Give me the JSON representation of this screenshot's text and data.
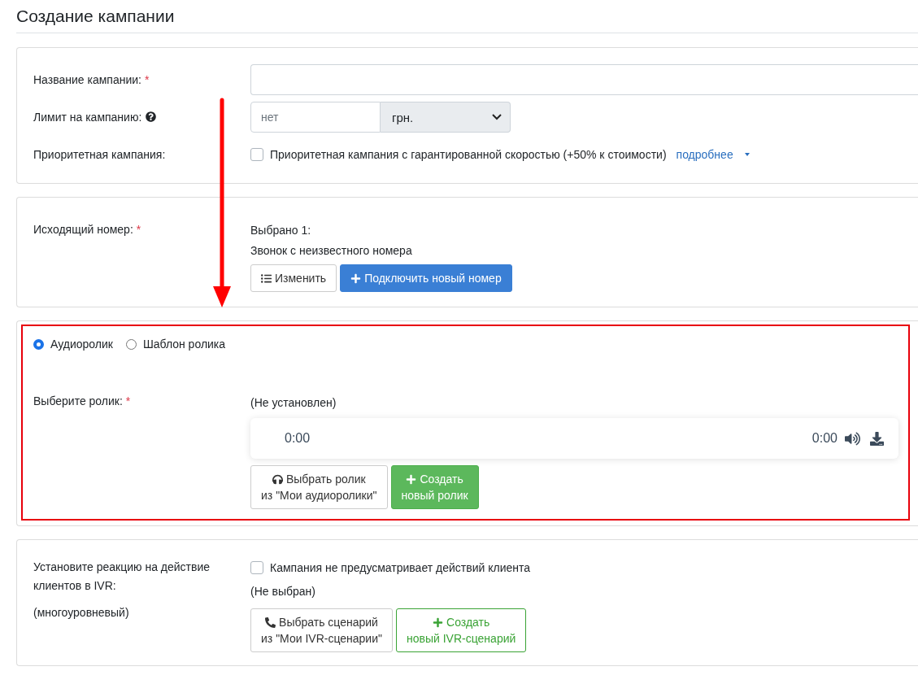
{
  "title": "Создание кампании",
  "campaign": {
    "name_field": {
      "label": "Название кампании:",
      "mark": "*"
    },
    "limit_field": {
      "label": "Лимит на кампанию:",
      "placeholder": "нет",
      "currency": "грн."
    },
    "priority": {
      "label": "Приоритетная кампания:",
      "checked": false,
      "text": "Приоритетная кампания с гарантированной скоростью (+50% к стоимости)",
      "link": "подробнее"
    }
  },
  "number": {
    "label": "Исходящий номер:",
    "mark": "*",
    "count": "Выбрано 1:",
    "selected": "Звонок с неизвестного номера",
    "buttons": [
      {
        "kind": "edit",
        "lines": [
          "Изменить"
        ]
      },
      {
        "kind": "connect",
        "lines": [
          "Подключить новый номер"
        ]
      }
    ]
  },
  "audio": {
    "highlighted": true,
    "radios": [
      {
        "label": "Аудиоролик",
        "selected": true
      },
      {
        "label": "Шаблон ролика",
        "selected": false
      }
    ],
    "label": "Выберите ролик:",
    "mark": "*",
    "status": "(Не установлен)",
    "player": {
      "current": "0:00",
      "duration": "0:00"
    },
    "buttons": [
      {
        "kind": "choose",
        "lines": [
          "Выбрать ролик",
          "из \"Мои аудиоролики\""
        ]
      },
      {
        "kind": "create",
        "lines": [
          "Создать",
          "новый ролик"
        ]
      }
    ]
  },
  "ivr": {
    "label": "Установите реакцию на действие клиентов в IVR:",
    "note": "(многоуровневый)",
    "checkbox": {
      "text": "Кампания не предусматривает действий клиента",
      "checked": false
    },
    "status": "(Не выбран)",
    "buttons": [
      {
        "kind": "scenario",
        "lines": [
          "Выбрать сценарий",
          "из \"Мои IVR-сценарии\""
        ]
      },
      {
        "kind": "newscenario",
        "lines": [
          "Создать",
          "новый IVR-сценарий"
        ]
      }
    ]
  },
  "annotation": {
    "arrow": true
  }
}
